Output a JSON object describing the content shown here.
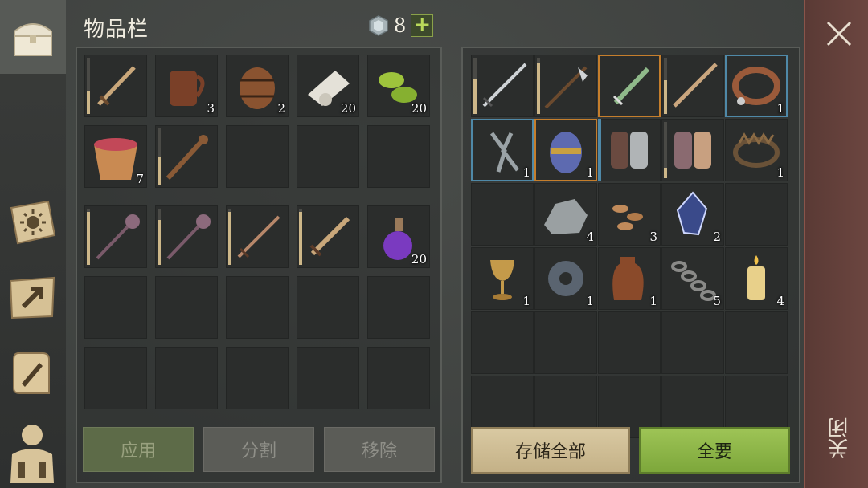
{
  "sidebar": {
    "items": [
      {
        "name": "inventory-chest-icon",
        "active": true
      },
      {
        "name": "journal-sun-icon"
      },
      {
        "name": "crafting-map-icon"
      },
      {
        "name": "quest-scroll-icon"
      },
      {
        "name": "character-icon"
      }
    ]
  },
  "header": {
    "title": "物品栏",
    "currency_value": "8",
    "add_label": "+"
  },
  "left_grid": {
    "rows": [
      [
        {
          "item": "sword-icon",
          "durability": 0.42
        },
        {
          "item": "tankard-icon",
          "count": "3"
        },
        {
          "item": "barrel-icon",
          "count": "2"
        },
        {
          "item": "cloth-roll-icon",
          "count": "20"
        },
        {
          "item": "cucumber-slices-icon",
          "count": "20"
        }
      ],
      [
        {
          "item": "berry-bucket-icon",
          "count": "7"
        },
        {
          "item": "spiked-club-icon",
          "durability": 0.5
        },
        {},
        {},
        {}
      ]
    ]
  },
  "left_grid2": {
    "rows": [
      [
        {
          "item": "mace-icon",
          "durability": 0.95
        },
        {
          "item": "mace-icon",
          "durability": 0.8
        },
        {
          "item": "long-sword-icon",
          "durability": 0.95
        },
        {
          "item": "short-sword-icon",
          "durability": 0.95
        },
        {
          "item": "purple-potion-icon",
          "count": "20"
        }
      ],
      [
        {},
        {},
        {},
        {},
        {}
      ],
      [
        {},
        {},
        {},
        {},
        {}
      ]
    ]
  },
  "right_grid": {
    "rows": [
      [
        {
          "item": "longsword-icon",
          "durability": 0.62
        },
        {
          "item": "halberd-icon",
          "durability": 0.9
        },
        {
          "item": "serpent-dagger-icon",
          "rarity": "orange"
        },
        {
          "item": "long-blade-icon",
          "durability": 0.6
        },
        {
          "item": "leather-collar-icon",
          "count": "1",
          "rarity": "blue"
        }
      ],
      [
        {
          "item": "pliers-icon",
          "count": "1",
          "rarity": "blue"
        },
        {
          "item": "ornate-egg-icon",
          "count": "1",
          "rarity": "orange"
        },
        {
          "item": "gauntlets-icon",
          "rarity": "blue-left"
        },
        {
          "item": "chainmail-gloves-icon",
          "durability": 0.18
        },
        {
          "item": "bear-trap-icon",
          "count": "1"
        }
      ],
      [
        {},
        {
          "item": "ore-icon",
          "count": "4"
        },
        {
          "item": "seeds-icon",
          "count": "3"
        },
        {
          "item": "crystal-icon",
          "count": "2"
        },
        {}
      ],
      [
        {
          "item": "goblet-icon",
          "count": "1"
        },
        {
          "item": "gear-part-icon",
          "count": "1"
        },
        {
          "item": "leather-flask-icon",
          "count": "1"
        },
        {
          "item": "chain-icon",
          "count": "5"
        },
        {
          "item": "candle-icon",
          "count": "4"
        }
      ],
      [
        {},
        {},
        {},
        {},
        {}
      ],
      [
        {},
        {},
        {},
        {},
        {}
      ]
    ]
  },
  "buttons": {
    "apply": "应用",
    "split": "分割",
    "remove": "移除",
    "store_all": "存储全部",
    "take_all": "全要"
  },
  "close": {
    "label": "关闭"
  }
}
